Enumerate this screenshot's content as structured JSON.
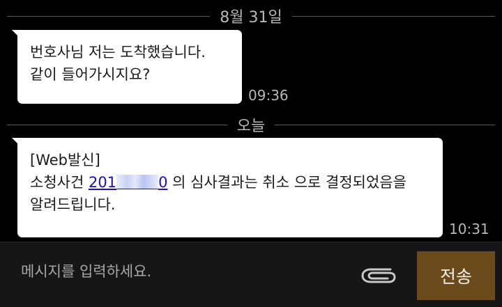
{
  "chat": {
    "dividers": [
      {
        "label": "8월 31일"
      },
      {
        "label": "오늘"
      }
    ],
    "messages": [
      {
        "lines": [
          "번호사님 저는 도착했습니다.",
          "같이 들어가시지요?"
        ],
        "time": "09:36"
      },
      {
        "line1": "[Web발신]",
        "line2_pre": "소청사건 ",
        "link_start": "201",
        "link_end": "0",
        "line2_post": " 의 심사결과는 취소 으로 결정되었음을",
        "line3": "알려드립니다.",
        "time": "10:31"
      }
    ]
  },
  "composer": {
    "placeholder": "메시지를 입력하세요.",
    "attach_icon": "paperclip-icon",
    "send_label": "전송"
  },
  "colors": {
    "background": "#000000",
    "bubble": "#ffffff",
    "link": "#1a0dcc",
    "send_button": "#6b4a1c",
    "input_bar": "#161616"
  }
}
